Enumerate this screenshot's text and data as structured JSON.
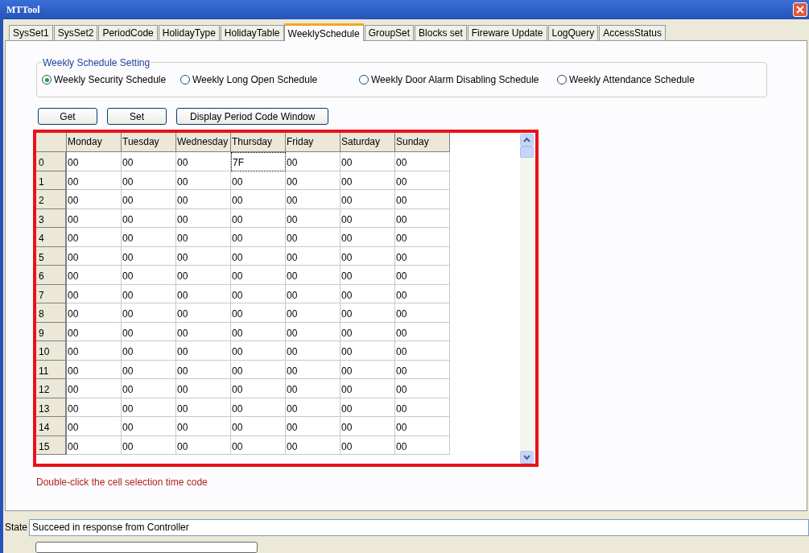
{
  "window": {
    "title": "MTTool"
  },
  "tabs": [
    {
      "label": "SysSet1",
      "selected": false
    },
    {
      "label": "SysSet2",
      "selected": false
    },
    {
      "label": "PeriodCode",
      "selected": false
    },
    {
      "label": "HolidayType",
      "selected": false
    },
    {
      "label": "HolidayTable",
      "selected": false
    },
    {
      "label": "WeeklySchedule",
      "selected": true
    },
    {
      "label": "GroupSet",
      "selected": false
    },
    {
      "label": "Blocks set",
      "selected": false
    },
    {
      "label": "Fireware Update",
      "selected": false
    },
    {
      "label": "LogQuery",
      "selected": false
    },
    {
      "label": "AccessStatus",
      "selected": false
    }
  ],
  "schedule_group": {
    "title": "Weekly Schedule Setting",
    "options": [
      {
        "label": "Weekly Security Schedule",
        "selected": true
      },
      {
        "label": "Weekly Long Open Schedule",
        "selected": false
      },
      {
        "label": "Weekly Door Alarm Disabling Schedule",
        "selected": false
      },
      {
        "label": "Weekly Attendance Schedule",
        "selected": false
      }
    ]
  },
  "buttons": [
    "Get",
    "Set",
    "Display Period Code Window"
  ],
  "table": {
    "columns": [
      "Monday",
      "Tuesday",
      "Wednesday",
      "Thursday",
      "Friday",
      "Saturday",
      "Sunday"
    ],
    "rows": [
      {
        "label": "0",
        "cells": [
          {
            "value": "00",
            "focused": false
          },
          {
            "value": "00",
            "focused": false
          },
          {
            "value": "00",
            "focused": false
          },
          {
            "value": "7F",
            "focused": true
          },
          {
            "value": "00",
            "focused": false
          },
          {
            "value": "00",
            "focused": false
          },
          {
            "value": "00",
            "focused": false
          }
        ]
      },
      {
        "label": "1",
        "cells": [
          {
            "value": "00",
            "focused": false
          },
          {
            "value": "00",
            "focused": false
          },
          {
            "value": "00",
            "focused": false
          },
          {
            "value": "00",
            "focused": false
          },
          {
            "value": "00",
            "focused": false
          },
          {
            "value": "00",
            "focused": false
          },
          {
            "value": "00",
            "focused": false
          }
        ]
      },
      {
        "label": "2",
        "cells": [
          {
            "value": "00",
            "focused": false
          },
          {
            "value": "00",
            "focused": false
          },
          {
            "value": "00",
            "focused": false
          },
          {
            "value": "00",
            "focused": false
          },
          {
            "value": "00",
            "focused": false
          },
          {
            "value": "00",
            "focused": false
          },
          {
            "value": "00",
            "focused": false
          }
        ]
      },
      {
        "label": "3",
        "cells": [
          {
            "value": "00",
            "focused": false
          },
          {
            "value": "00",
            "focused": false
          },
          {
            "value": "00",
            "focused": false
          },
          {
            "value": "00",
            "focused": false
          },
          {
            "value": "00",
            "focused": false
          },
          {
            "value": "00",
            "focused": false
          },
          {
            "value": "00",
            "focused": false
          }
        ]
      },
      {
        "label": "4",
        "cells": [
          {
            "value": "00",
            "focused": false
          },
          {
            "value": "00",
            "focused": false
          },
          {
            "value": "00",
            "focused": false
          },
          {
            "value": "00",
            "focused": false
          },
          {
            "value": "00",
            "focused": false
          },
          {
            "value": "00",
            "focused": false
          },
          {
            "value": "00",
            "focused": false
          }
        ]
      },
      {
        "label": "5",
        "cells": [
          {
            "value": "00",
            "focused": false
          },
          {
            "value": "00",
            "focused": false
          },
          {
            "value": "00",
            "focused": false
          },
          {
            "value": "00",
            "focused": false
          },
          {
            "value": "00",
            "focused": false
          },
          {
            "value": "00",
            "focused": false
          },
          {
            "value": "00",
            "focused": false
          }
        ]
      },
      {
        "label": "6",
        "cells": [
          {
            "value": "00",
            "focused": false
          },
          {
            "value": "00",
            "focused": false
          },
          {
            "value": "00",
            "focused": false
          },
          {
            "value": "00",
            "focused": false
          },
          {
            "value": "00",
            "focused": false
          },
          {
            "value": "00",
            "focused": false
          },
          {
            "value": "00",
            "focused": false
          }
        ]
      },
      {
        "label": "7",
        "cells": [
          {
            "value": "00",
            "focused": false
          },
          {
            "value": "00",
            "focused": false
          },
          {
            "value": "00",
            "focused": false
          },
          {
            "value": "00",
            "focused": false
          },
          {
            "value": "00",
            "focused": false
          },
          {
            "value": "00",
            "focused": false
          },
          {
            "value": "00",
            "focused": false
          }
        ]
      },
      {
        "label": "8",
        "cells": [
          {
            "value": "00",
            "focused": false
          },
          {
            "value": "00",
            "focused": false
          },
          {
            "value": "00",
            "focused": false
          },
          {
            "value": "00",
            "focused": false
          },
          {
            "value": "00",
            "focused": false
          },
          {
            "value": "00",
            "focused": false
          },
          {
            "value": "00",
            "focused": false
          }
        ]
      },
      {
        "label": "9",
        "cells": [
          {
            "value": "00",
            "focused": false
          },
          {
            "value": "00",
            "focused": false
          },
          {
            "value": "00",
            "focused": false
          },
          {
            "value": "00",
            "focused": false
          },
          {
            "value": "00",
            "focused": false
          },
          {
            "value": "00",
            "focused": false
          },
          {
            "value": "00",
            "focused": false
          }
        ]
      },
      {
        "label": "10",
        "cells": [
          {
            "value": "00",
            "focused": false
          },
          {
            "value": "00",
            "focused": false
          },
          {
            "value": "00",
            "focused": false
          },
          {
            "value": "00",
            "focused": false
          },
          {
            "value": "00",
            "focused": false
          },
          {
            "value": "00",
            "focused": false
          },
          {
            "value": "00",
            "focused": false
          }
        ]
      },
      {
        "label": "11",
        "cells": [
          {
            "value": "00",
            "focused": false
          },
          {
            "value": "00",
            "focused": false
          },
          {
            "value": "00",
            "focused": false
          },
          {
            "value": "00",
            "focused": false
          },
          {
            "value": "00",
            "focused": false
          },
          {
            "value": "00",
            "focused": false
          },
          {
            "value": "00",
            "focused": false
          }
        ]
      },
      {
        "label": "12",
        "cells": [
          {
            "value": "00",
            "focused": false
          },
          {
            "value": "00",
            "focused": false
          },
          {
            "value": "00",
            "focused": false
          },
          {
            "value": "00",
            "focused": false
          },
          {
            "value": "00",
            "focused": false
          },
          {
            "value": "00",
            "focused": false
          },
          {
            "value": "00",
            "focused": false
          }
        ]
      },
      {
        "label": "13",
        "cells": [
          {
            "value": "00",
            "focused": false
          },
          {
            "value": "00",
            "focused": false
          },
          {
            "value": "00",
            "focused": false
          },
          {
            "value": "00",
            "focused": false
          },
          {
            "value": "00",
            "focused": false
          },
          {
            "value": "00",
            "focused": false
          },
          {
            "value": "00",
            "focused": false
          }
        ]
      },
      {
        "label": "14",
        "cells": [
          {
            "value": "00",
            "focused": false
          },
          {
            "value": "00",
            "focused": false
          },
          {
            "value": "00",
            "focused": false
          },
          {
            "value": "00",
            "focused": false
          },
          {
            "value": "00",
            "focused": false
          },
          {
            "value": "00",
            "focused": false
          },
          {
            "value": "00",
            "focused": false
          }
        ]
      },
      {
        "label": "15",
        "cells": [
          {
            "value": "00",
            "focused": false
          },
          {
            "value": "00",
            "focused": false
          },
          {
            "value": "00",
            "focused": false
          },
          {
            "value": "00",
            "focused": false
          },
          {
            "value": "00",
            "focused": false
          },
          {
            "value": "00",
            "focused": false
          },
          {
            "value": "00",
            "focused": false
          }
        ]
      }
    ]
  },
  "hint": "Double-click the cell selection time code",
  "status": {
    "label": "State",
    "value": "Succeed in response from Controller"
  },
  "progress": {
    "level": 0
  }
}
